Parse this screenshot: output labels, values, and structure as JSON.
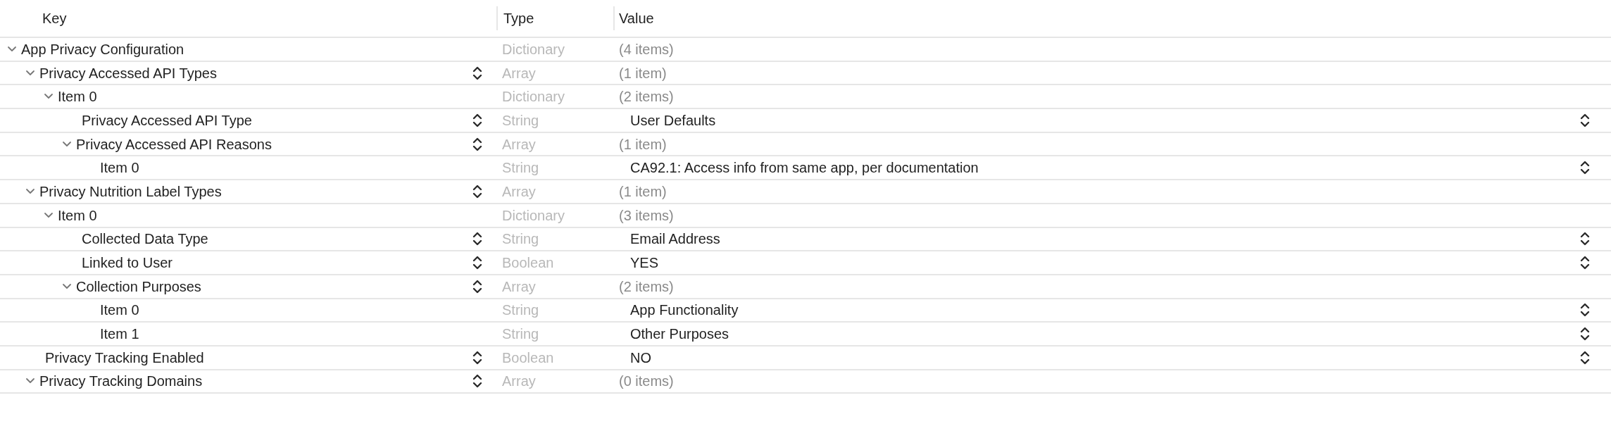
{
  "columns": [
    "Key",
    "Type",
    "Value"
  ],
  "rows": [
    {
      "key": "App Privacy Configuration",
      "type": "Dictionary",
      "value": "(4 items)",
      "kind": "container",
      "expanded": true,
      "key_popup": false,
      "value_popup": false,
      "children": [
        {
          "key": "Privacy Accessed API Types",
          "type": "Array",
          "value": "(1 item)",
          "kind": "container",
          "expanded": true,
          "key_popup": true,
          "value_popup": false,
          "children": [
            {
              "key": "Item 0",
              "type": "Dictionary",
              "value": "(2 items)",
              "kind": "container",
              "expanded": true,
              "key_popup": false,
              "value_popup": false,
              "children": [
                {
                  "key": "Privacy Accessed API Type",
                  "type": "String",
                  "value": "User Defaults",
                  "kind": "leaf",
                  "key_popup": true,
                  "value_popup": true
                },
                {
                  "key": "Privacy Accessed API Reasons",
                  "type": "Array",
                  "value": "(1 item)",
                  "kind": "container",
                  "expanded": true,
                  "key_popup": true,
                  "value_popup": false,
                  "children": [
                    {
                      "key": "Item 0",
                      "type": "String",
                      "value": "CA92.1: Access info from same app, per documentation",
                      "kind": "leaf",
                      "key_popup": false,
                      "value_popup": true
                    }
                  ]
                }
              ]
            }
          ]
        },
        {
          "key": "Privacy Nutrition Label Types",
          "type": "Array",
          "value": "(1 item)",
          "kind": "container",
          "expanded": true,
          "key_popup": true,
          "value_popup": false,
          "children": [
            {
              "key": "Item 0",
              "type": "Dictionary",
              "value": "(3 items)",
              "kind": "container",
              "expanded": true,
              "key_popup": false,
              "value_popup": false,
              "children": [
                {
                  "key": "Collected Data Type",
                  "type": "String",
                  "value": "Email Address",
                  "kind": "leaf",
                  "key_popup": true,
                  "value_popup": true
                },
                {
                  "key": "Linked to User",
                  "type": "Boolean",
                  "value": "YES",
                  "kind": "leaf",
                  "key_popup": true,
                  "value_popup": true
                },
                {
                  "key": "Collection Purposes",
                  "type": "Array",
                  "value": "(2 items)",
                  "kind": "container",
                  "expanded": true,
                  "key_popup": true,
                  "value_popup": false,
                  "children": [
                    {
                      "key": "Item 0",
                      "type": "String",
                      "value": "App Functionality",
                      "kind": "leaf",
                      "key_popup": false,
                      "value_popup": true
                    },
                    {
                      "key": "Item 1",
                      "type": "String",
                      "value": "Other Purposes",
                      "kind": "leaf",
                      "key_popup": false,
                      "value_popup": true
                    }
                  ]
                }
              ]
            }
          ]
        },
        {
          "key": "Privacy Tracking Enabled",
          "type": "Boolean",
          "value": "NO",
          "kind": "leaf",
          "key_popup": true,
          "value_popup": true
        },
        {
          "key": "Privacy Tracking Domains",
          "type": "Array",
          "value": "(0 items)",
          "kind": "container",
          "expanded": true,
          "key_popup": true,
          "value_popup": false
        }
      ]
    }
  ]
}
